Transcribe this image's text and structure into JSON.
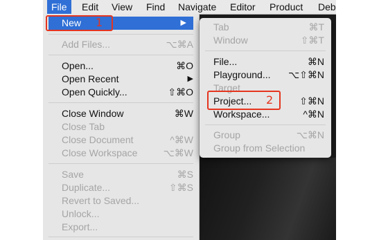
{
  "menubar": {
    "file": "File",
    "edit": "Edit",
    "view": "View",
    "find": "Find",
    "navigate": "Navigate",
    "editor": "Editor",
    "product": "Product",
    "debug": "Deb"
  },
  "file_menu": [
    {
      "label": "New",
      "shortcut": "▶"
    },
    {
      "label": "Add Files...",
      "shortcut": "⌥⌘A"
    },
    {
      "label": "Open...",
      "shortcut": "⌘O"
    },
    {
      "label": "Open Recent",
      "shortcut": "▶"
    },
    {
      "label": "Open Quickly...",
      "shortcut": "⇧⌘O"
    },
    {
      "label": "Close Window",
      "shortcut": "⌘W"
    },
    {
      "label": "Close Tab",
      "shortcut": ""
    },
    {
      "label": "Close Document",
      "shortcut": "^⌘W"
    },
    {
      "label": "Close Workspace",
      "shortcut": "⌥⌘W"
    },
    {
      "label": "Save",
      "shortcut": "⌘S"
    },
    {
      "label": "Duplicate...",
      "shortcut": "⇧⌘S"
    },
    {
      "label": "Revert to Saved...",
      "shortcut": ""
    },
    {
      "label": "Unlock...",
      "shortcut": ""
    },
    {
      "label": "Export...",
      "shortcut": ""
    }
  ],
  "new_submenu": [
    {
      "label": "Tab",
      "shortcut": "⌘T"
    },
    {
      "label": "Window",
      "shortcut": "⇧⌘T"
    },
    {
      "label": "File...",
      "shortcut": "⌘N"
    },
    {
      "label": "Playground...",
      "shortcut": "⌥⇧⌘N"
    },
    {
      "label": "Target",
      "shortcut": ""
    },
    {
      "label": "Project...",
      "shortcut": "⇧⌘N"
    },
    {
      "label": "Workspace...",
      "shortcut": "^⌘N"
    },
    {
      "label": "Group",
      "shortcut": "⌥⌘N"
    },
    {
      "label": "Group from Selection",
      "shortcut": ""
    }
  ],
  "annotations": {
    "step1": "1",
    "step2": "2"
  }
}
